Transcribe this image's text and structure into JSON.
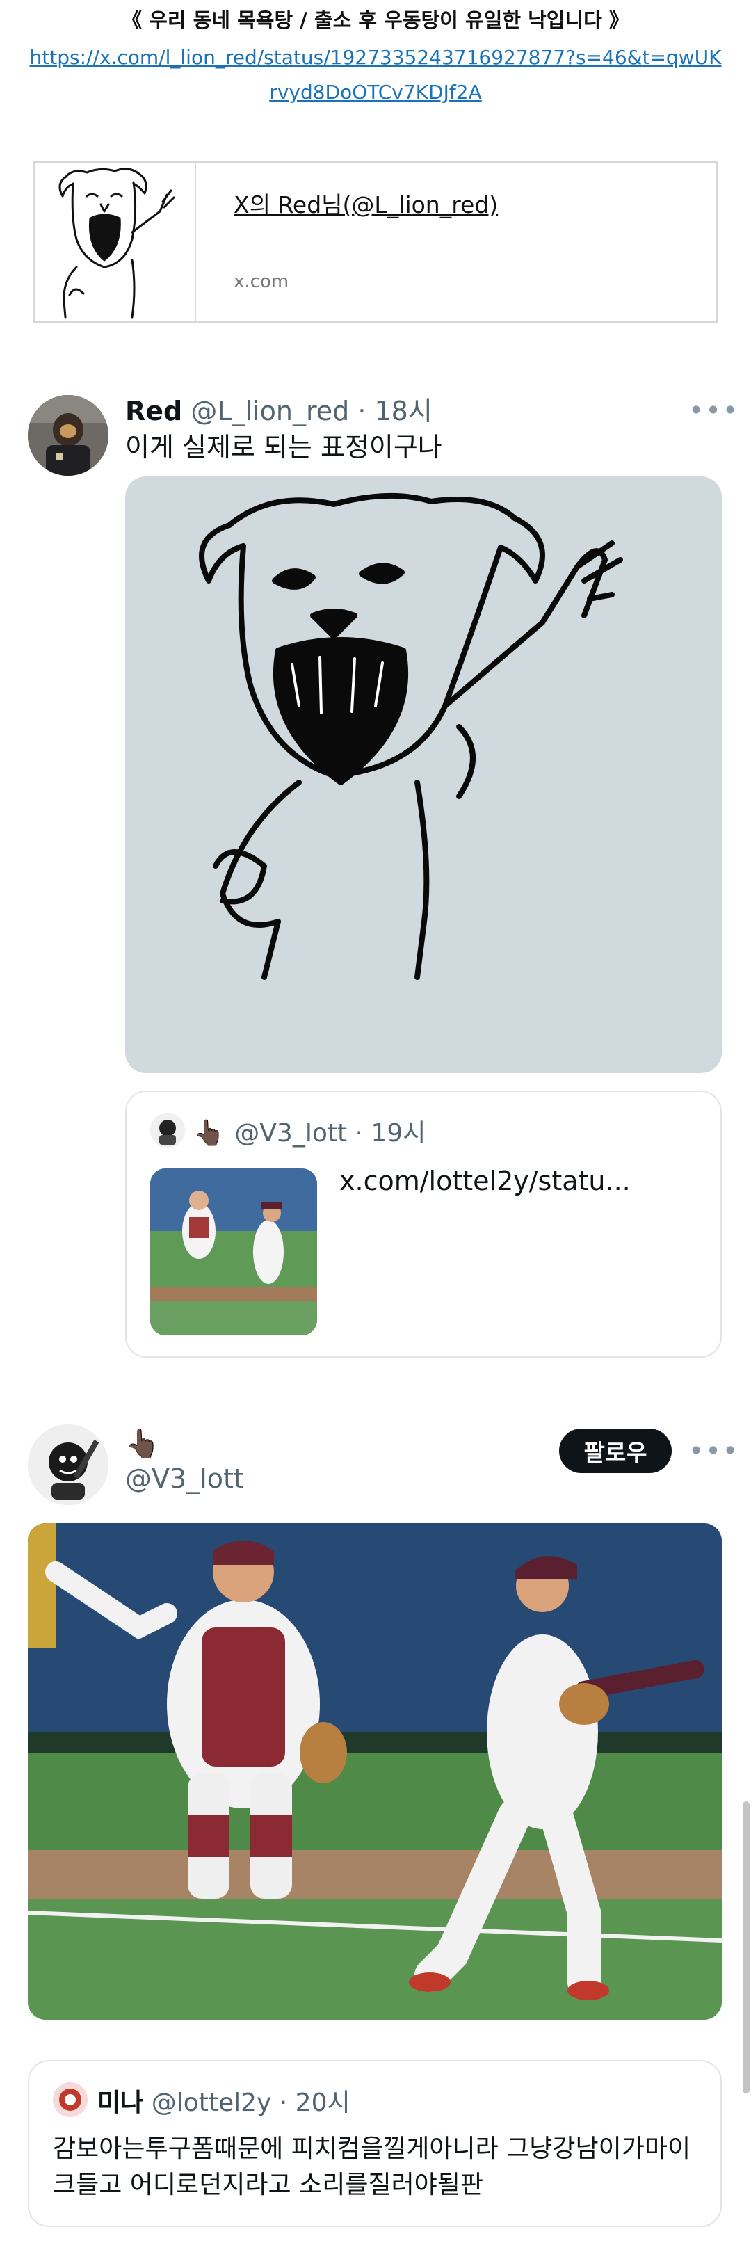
{
  "article": {
    "title": "《 우리 동네 목욕탕 / 출소 후 우동탕이 유일한 낙입니다 》",
    "source_link": "https://x.com/l_lion_red/status/1927335243716927877?s=46&t=qwUKrvyd8DoOTCv7KDJf2A"
  },
  "link_card": {
    "title": "X의 Red님(@L_lion_red)",
    "domain": "x.com"
  },
  "tweet1": {
    "author_name": "Red",
    "handle": "@L_lion_red",
    "time": "· 18시",
    "more_icon": "more-horizontal-icon",
    "text": "이게 실제로 되는 표정이구나",
    "quote": {
      "author_emoji": "👆🏿",
      "handle": "@V3_lott",
      "time": "· 19시",
      "link": "x.com/lottel2y/statu..."
    }
  },
  "tweet2": {
    "author_emoji": "👆🏿",
    "handle": "@V3_lott",
    "follow_label": "팔로우",
    "more_icon": "more-horizontal-icon",
    "quote": {
      "author_name": "미나",
      "handle": "@lottel2y",
      "time": "· 20시",
      "text": "감보아는투구폼때문에 피치컴을낄게아니라 그냥강남이가마이크들고 어디로던지라고 소리를질러야될판"
    }
  },
  "colors": {
    "link": "#1a73b8",
    "text": "#0f1419",
    "secondary": "#536471",
    "media_bg": "#cfd9de",
    "border": "#dfe5e8"
  }
}
